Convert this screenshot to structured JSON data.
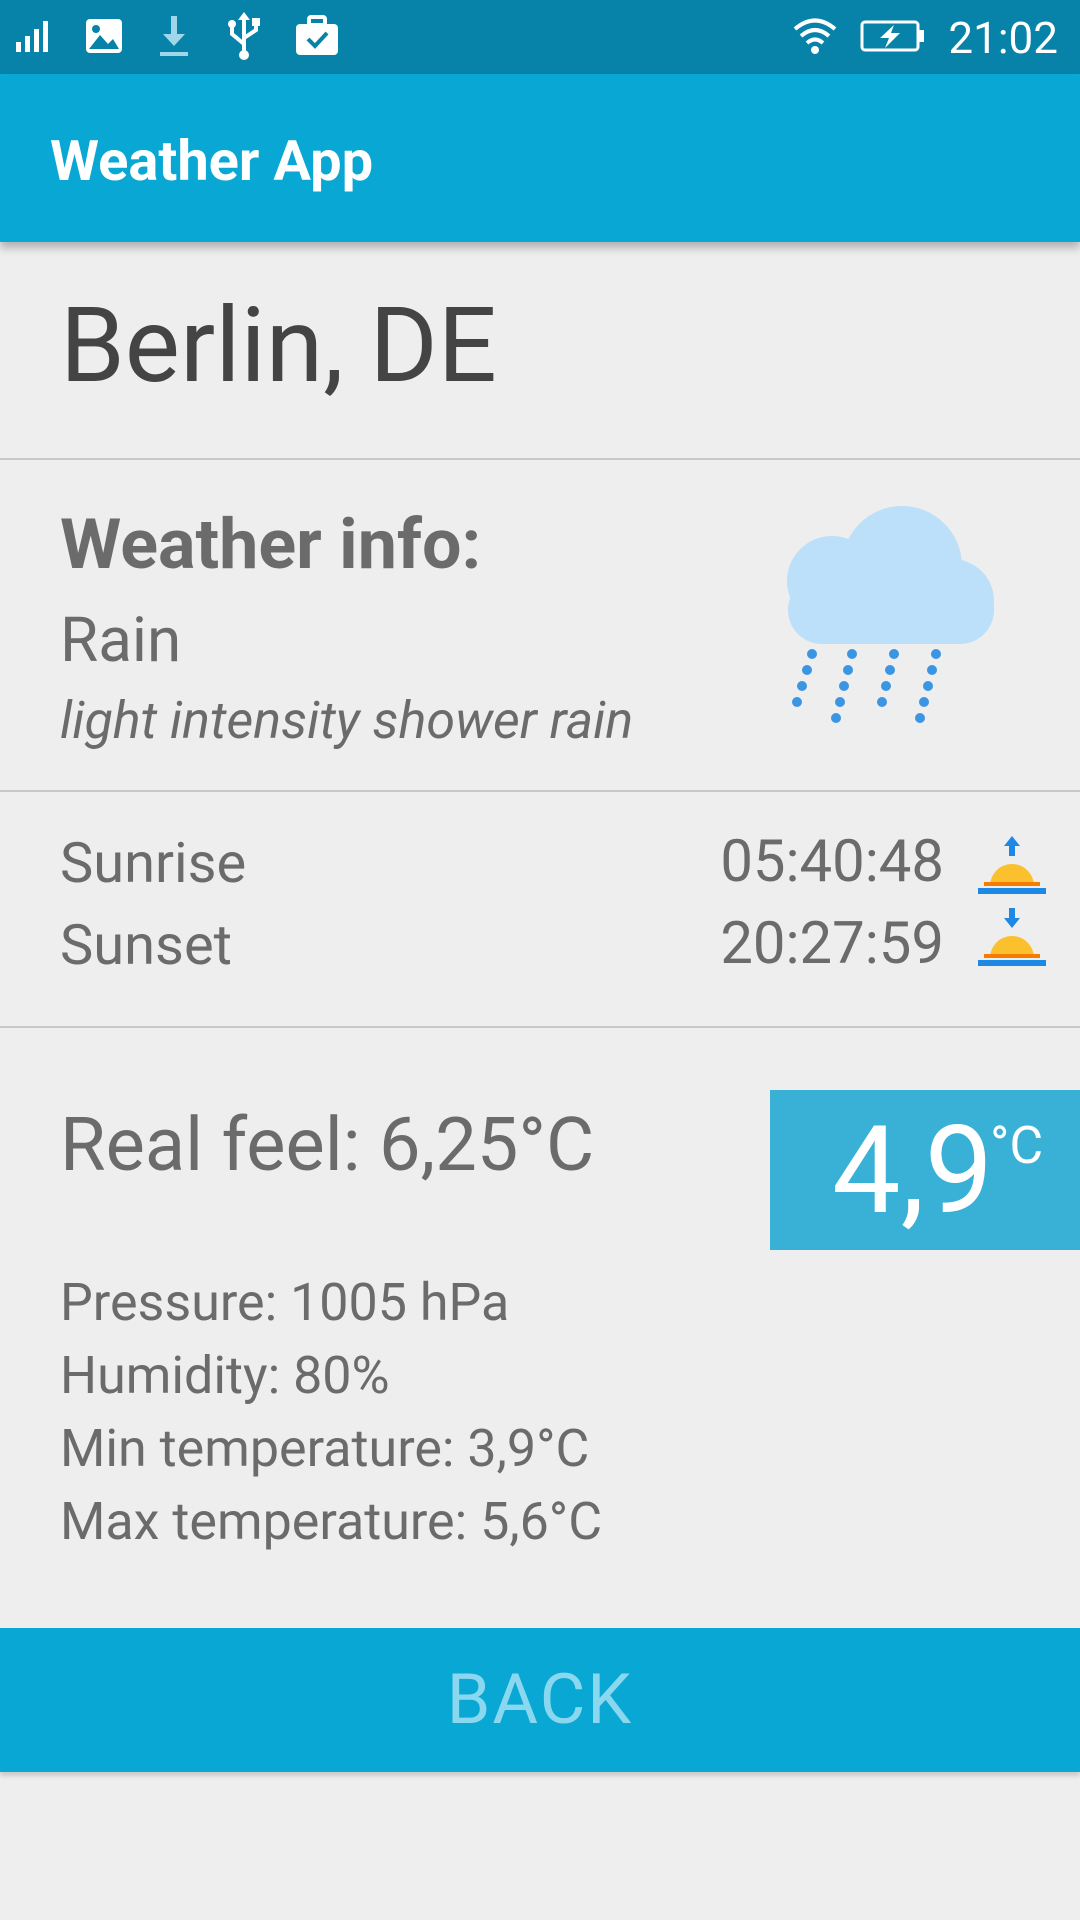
{
  "status_bar": {
    "time": "21:02",
    "icons": [
      "signal-icon",
      "gallery-icon",
      "download-icon",
      "usb-icon",
      "briefcase-check-icon",
      "wifi-icon",
      "battery-charging-icon"
    ]
  },
  "app_bar": {
    "title": "Weather App"
  },
  "location": {
    "city": "Berlin, DE"
  },
  "weather": {
    "heading": "Weather info:",
    "main": "Rain",
    "description": "light intensity shower rain",
    "icon": "rain-cloud-icon"
  },
  "sun": {
    "sunrise_label": "Sunrise",
    "sunrise_time": "05:40:48",
    "sunset_label": "Sunset",
    "sunset_time": "20:27:59"
  },
  "temperature": {
    "real_feel": "Real feel: 6,25°C",
    "current": "4,9",
    "unit": "°C"
  },
  "details": {
    "pressure": "Pressure: 1005 hPa",
    "humidity": "Humidity: 80%",
    "min_temp": "Min temperature: 3,9°C",
    "max_temp": "Max temperature: 5,6°C"
  },
  "actions": {
    "back_label": "BACK"
  },
  "colors": {
    "status_bar": "#0783a9",
    "app_bar": "#09a7d3",
    "temp_box": "#39b0d6",
    "back_text": "#8ad8ef",
    "background": "#eeeeee"
  }
}
